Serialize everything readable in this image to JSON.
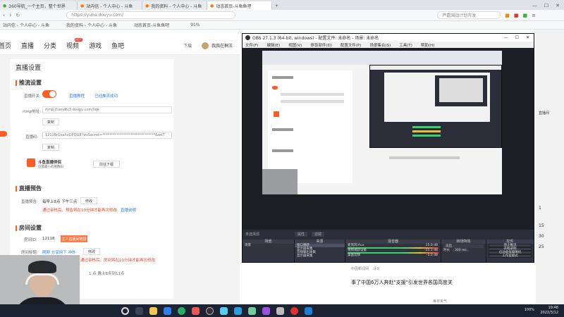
{
  "browser": {
    "tabs": [
      {
        "label": "360导航_一个主页，整个世界",
        "active": false
      },
      {
        "label": "站内信 - 个人中心 - 斗鱼",
        "active": false
      },
      {
        "label": "我的资料 - 个人中心 - 斗鱼",
        "active": false
      },
      {
        "label": "动态首页-斗鱼鱼吧",
        "active": true
      }
    ],
    "url": "https://yuba.douyu.com/",
    "search_placeholder": "芦嘉国战计划开发",
    "zoom": "91%",
    "bookmarks": [
      "站内信 - 个人中心 - 斗鱼",
      "我的资料 - 个人中心 - 斗鱼",
      "动态首页-斗鱼鱼吧"
    ],
    "side_numbers": [
      "1",
      "15",
      "30",
      "25"
    ],
    "side_label": "直播间"
  },
  "douyu": {
    "nav": [
      "首页",
      "直播",
      "分类",
      "视频",
      "游戏",
      "鱼吧"
    ],
    "hot_badge": "HOT",
    "download": "下载",
    "username": "我我在桐王",
    "page_title": "直播设置",
    "push": {
      "section_title": "推流设置",
      "switch_label": "直播开关:",
      "links": [
        "直播教程",
        "已经推流成功"
      ],
      "rtmp_label": "rtmp地址:",
      "rtmp_value": "rtmp://sendtc3.douyu.com/live",
      "copy_btn": "复制",
      "code_label": "直播码:",
      "code_value": "12118rUzaXxDPQG8?wsSecret=******************************&wsT",
      "copy_btn2": "复制",
      "assistant_title": "斗鱼直播伴侣",
      "assistant_sub": "仅需最小的图像码",
      "assistant_btn": "前往下载"
    },
    "preview": {
      "section_title": "直播预告",
      "label": "直播预告:",
      "value": "每早上8点 下午三点",
      "edit_btn": "修改",
      "warn": "通过审核后，预告将在10分钟才能再次修改",
      "link": "直播说明"
    },
    "room": {
      "section_title": "房间设置",
      "id_label": "房间ID:",
      "id_value": "12118",
      "id_btn": "主人直播间链接",
      "title_label": "房间标题:",
      "title_value": "刚刚 分享网下 冲外",
      "title_btn": "修改",
      "warn": "通过审核后，房间将在10分钟才能再次修改",
      "notice": "1.点 晚上8点到11点"
    }
  },
  "obs": {
    "title": "OBS 27.1.3 (64-bit, windows) - 配置文件: 未命名 - 场景: 未命名",
    "menu": [
      "文件(F)",
      "编辑(E)",
      "视图(V)",
      "停靠部件(D)",
      "配置文件(P)",
      "场景集合(S)",
      "工具(T)",
      "帮助(H)"
    ],
    "source_label": "未选择源",
    "prop_btn": "属性",
    "filter_btn": "滤镜",
    "scenes_head": "场景",
    "scenes": [
      "场景"
    ],
    "sources_head": "来源",
    "sources": [
      "窗口捕获",
      "显示器采集",
      "音频输出采集",
      "显示器采集",
      "图像",
      "窗口采集"
    ],
    "mixer_head": "混音器",
    "mixer": [
      {
        "name": "麦克风/Aux",
        "db": "15.0 dB"
      },
      {
        "name": "视频捕获设备",
        "db": "-25.3 dB"
      },
      {
        "name": "桌面音频",
        "db": "-5.0 dB"
      }
    ],
    "transition_head": "转场特效",
    "transition_type": "淡出",
    "duration_label": "时长",
    "duration_value": "300 ms",
    "controls_head": "控件",
    "controls": [
      "停止推流",
      "开始录制",
      "启动虚拟摄像机",
      "工作室模式",
      "设置",
      "退出"
    ],
    "status": [
      "LIVE: 00:03:51",
      "REC: 00:00:00",
      "CPU: 8.6%, 60.00 fps"
    ]
  },
  "news": {
    "source": "中国新闻网",
    "comment_count": "评论",
    "text": "事了中国6万人奔赴\"支援\"引发世界各国高度关",
    "weather": "每日天气"
  },
  "taskbar": {
    "time": "19:48",
    "date": "2022/3/12",
    "battery": "100%"
  }
}
